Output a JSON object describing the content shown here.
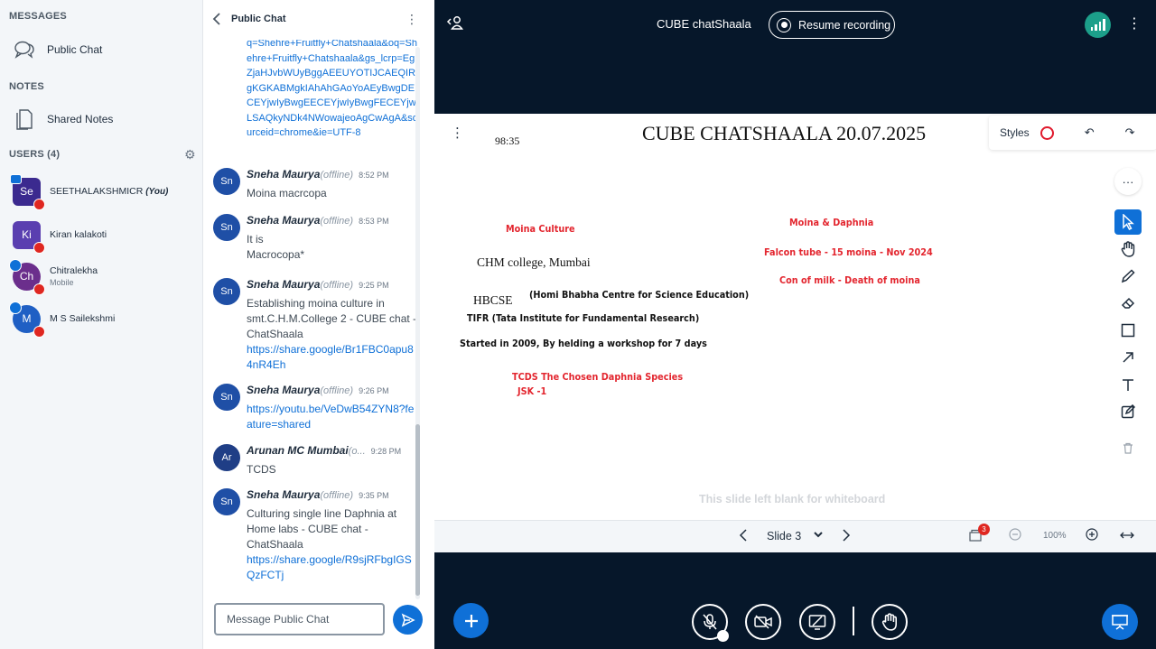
{
  "sidebar": {
    "messages_title": "MESSAGES",
    "public_chat_label": "Public Chat",
    "notes_title": "NOTES",
    "shared_notes_label": "Shared Notes",
    "users_title": "USERS (4)",
    "users": [
      {
        "initials": "Se",
        "name": "SEETHALAKSHMICR",
        "suffix": "(You)",
        "sub": "",
        "color": "#3B2A8F"
      },
      {
        "initials": "Ki",
        "name": "Kiran kalakoti",
        "suffix": "",
        "sub": "",
        "color": "#5A3FB0"
      },
      {
        "initials": "Ch",
        "name": "Chitralekha",
        "suffix": "",
        "sub": "Mobile",
        "color": "#6B2E8C"
      },
      {
        "initials": "M",
        "name": "M S Sailekshmi",
        "suffix": "",
        "sub": "",
        "color": "#1F5FC4"
      }
    ]
  },
  "chat": {
    "title": "Public Chat",
    "partial_link": "q=Shehre+Fruitfly+Chatshaala&oq=Shehre+Fruitfly+Chatshaala&gs_lcrp=EgZjaHJvbWUyBggAEEUYOTIJCAEQIRgKGKABMgkIAhAhGAoYoAEyBwgDECEYjwIyBwgEECEYjwIyBwgFECEYjwLSAQkyNDk4NWowajeoAgCwAgA&sourceid=chrome&ie=UTF-8",
    "offline_label": "(offline)",
    "messages": [
      {
        "initials": "Sn",
        "name": "Sneha Maurya",
        "time": "8:52 PM",
        "lines": [
          "Moina macrcopa"
        ],
        "link": ""
      },
      {
        "initials": "Sn",
        "name": "Sneha Maurya",
        "time": "8:53 PM",
        "lines": [
          "It is",
          "Macrocopa*"
        ],
        "link": ""
      },
      {
        "initials": "Sn",
        "name": "Sneha Maurya",
        "time": "9:25 PM",
        "lines": [
          "Establishing moina culture in smt.C.H.M.College 2 - CUBE chat - ChatShaala"
        ],
        "link": "https://share.google/Br1FBC0apu84nR4Eh"
      },
      {
        "initials": "Sn",
        "name": "Sneha Maurya",
        "time": "9:26 PM",
        "lines": [],
        "link": "https://youtu.be/VeDwB54ZYN8?feature=shared"
      },
      {
        "initials": "Ar",
        "name": "Arunan MC Mumbai",
        "offline": "(o...",
        "time": "9:28 PM",
        "lines": [
          "TCDS"
        ],
        "link": ""
      },
      {
        "initials": "Sn",
        "name": "Sneha Maurya",
        "time": "9:35 PM",
        "lines": [
          "Culturing single line Daphnia at Home labs - CUBE chat - ChatShaala"
        ],
        "link": "https://share.google/R9sjRFbgIGSQzFCTj"
      }
    ],
    "input_placeholder": "Message Public Chat"
  },
  "main": {
    "meeting_title": "CUBE chatShaala",
    "recording_label": "Resume recording",
    "slide": {
      "timer": "98:35",
      "title": "CUBE CHATSHAALA 20.07.2025",
      "styles_label": "Styles",
      "notes": {
        "moina_culture": "Moina Culture",
        "chm_college": "CHM college,  Mumbai",
        "hbcse": "HBCSE",
        "hbcse_full": "(Homi Bhabha Centre for Science Education)",
        "tifr": "TIFR (Tata Institute for Fundamental Research)",
        "started": "Started in 2009, By helding a workshop for 7 days",
        "tcds": "TCDS The Chosen Daphnia Species",
        "jsk": "JSK -1",
        "moina_daphnia": "Moina & Daphnia",
        "falcon": "Falcon tube - 15 moina - Nov 2024",
        "con_milk": "Con of milk - Death of moina"
      },
      "blank_note": "This slide left blank for whiteboard"
    },
    "slide_bar": {
      "slide_label": "Slide 3",
      "polls_count": "3",
      "zoom": "100%"
    },
    "colors": {
      "accent": "#0F70D7",
      "dark_bg": "#06172A",
      "handwriting_red": "#E3262F"
    }
  }
}
